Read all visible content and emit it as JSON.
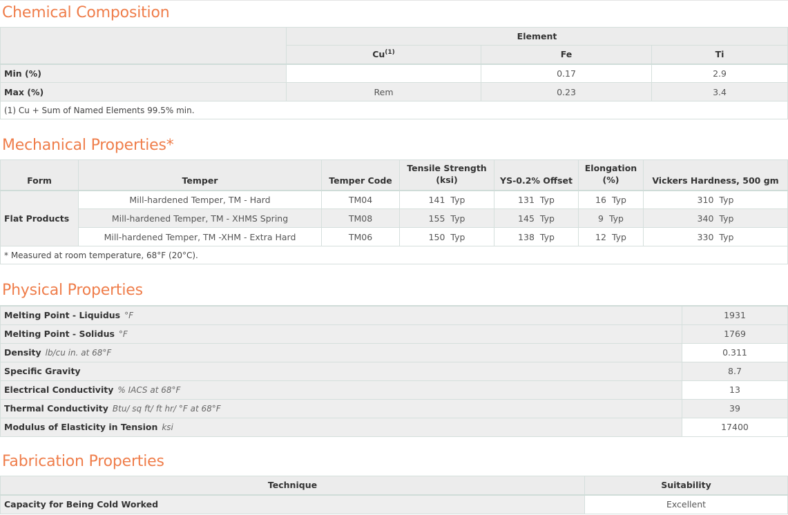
{
  "chemical": {
    "title": "Chemical Composition",
    "group_header": "Element",
    "columns": [
      "Cu",
      "Fe",
      "Ti"
    ],
    "cu_sup": "(1)",
    "rows": [
      {
        "label": "Min (%)",
        "values": [
          "",
          "0.17",
          "2.9"
        ]
      },
      {
        "label": "Max (%)",
        "values": [
          "Rem",
          "0.23",
          "3.4"
        ]
      }
    ],
    "note": "(1) Cu + Sum of Named Elements 99.5% min."
  },
  "mechanical": {
    "title": "Mechanical Properties*",
    "headers": {
      "form": "Form",
      "temper": "Temper",
      "temper_code": "Temper Code",
      "tensile_1": "Tensile Strength",
      "tensile_2": "(ksi)",
      "ys": "YS-0.2% Offset",
      "elong_1": "Elongation",
      "elong_2": "(%)",
      "vickers": "Vickers Hardness, 500 gm"
    },
    "form": "Flat Products",
    "typ": "Typ",
    "rows": [
      {
        "temper": "Mill-hardened Temper, TM - Hard",
        "code": "TM04",
        "tensile": "141",
        "ys": "131",
        "elong": "16",
        "vickers": "310"
      },
      {
        "temper": "Mill-hardened Temper, TM - XHMS Spring",
        "code": "TM08",
        "tensile": "155",
        "ys": "145",
        "elong": "9",
        "vickers": "340"
      },
      {
        "temper": "Mill-hardened Temper, TM -XHM - Extra Hard",
        "code": "TM06",
        "tensile": "150",
        "ys": "138",
        "elong": "12",
        "vickers": "330"
      }
    ],
    "note": "* Measured at room temperature, 68°F (20°C)."
  },
  "physical": {
    "title": "Physical Properties",
    "rows": [
      {
        "label": "Melting Point - Liquidus",
        "unit": "°F",
        "value": "1931"
      },
      {
        "label": "Melting Point - Solidus",
        "unit": "°F",
        "value": "1769"
      },
      {
        "label": "Density",
        "unit": "lb/cu in. at 68°F",
        "value": "0.311"
      },
      {
        "label": "Specific Gravity",
        "unit": "",
        "value": "8.7"
      },
      {
        "label": "Electrical Conductivity",
        "unit": "% IACS at 68°F",
        "value": "13"
      },
      {
        "label": "Thermal Conductivity",
        "unit": "Btu/ sq ft/ ft hr/ °F at 68°F",
        "value": "39"
      },
      {
        "label": "Modulus of Elasticity in Tension",
        "unit": "ksi",
        "value": "17400"
      }
    ]
  },
  "fabrication": {
    "title": "Fabrication Properties",
    "headers": {
      "technique": "Technique",
      "suitability": "Suitability"
    },
    "rows": [
      {
        "technique": "Capacity for Being Cold Worked",
        "suitability": "Excellent"
      }
    ]
  }
}
